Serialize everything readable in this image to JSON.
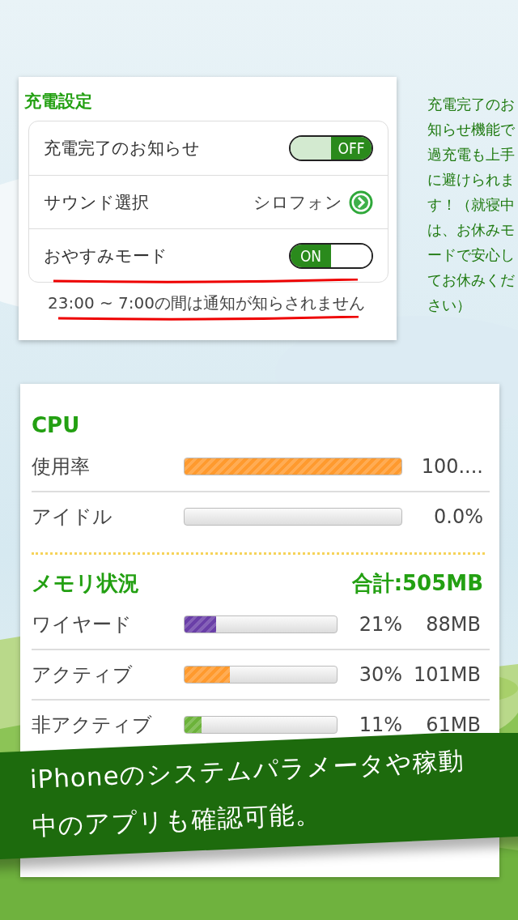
{
  "settings": {
    "title": "充電設定",
    "rows": [
      {
        "kind": "toggle",
        "label": "充電完了のお知らせ",
        "on": false,
        "switch_text": "OFF"
      },
      {
        "kind": "link",
        "label": "サウンド選択",
        "value": "シロフォン"
      },
      {
        "kind": "toggle",
        "label": "おやすみモード",
        "on": true,
        "switch_text": "ON"
      }
    ],
    "note": "23:00 ~ 7:00の間は通知が知らされません"
  },
  "side_note": "充電完了のお知らせ機能で過充電も上手に避けられます！（就寝中は、お休みモードで安心してお休みください）",
  "cpu": {
    "title": "CPU",
    "rows": [
      {
        "label": "使用率",
        "level": 1.0,
        "reading": "100...."
      },
      {
        "label": "アイドル",
        "level": 0.0,
        "reading": "0.0%"
      }
    ]
  },
  "memory": {
    "title": "メモリ状況",
    "total": "合計:505MB",
    "rows": [
      {
        "label": "ワイヤード",
        "level": 0.21,
        "color": "#6a3fa8",
        "percent": "21%",
        "size": "88MB"
      },
      {
        "label": "アクティブ",
        "level": 0.3,
        "color": "#ff9a2e",
        "percent": "30%",
        "size": "101MB"
      },
      {
        "label": "非アクティブ",
        "level": 0.11,
        "color": "#6cb33a",
        "percent": "11%",
        "size": "61MB"
      }
    ]
  },
  "banner": "iPhoneのシステムパラメータや稼動中のアプリも確認可能。"
}
